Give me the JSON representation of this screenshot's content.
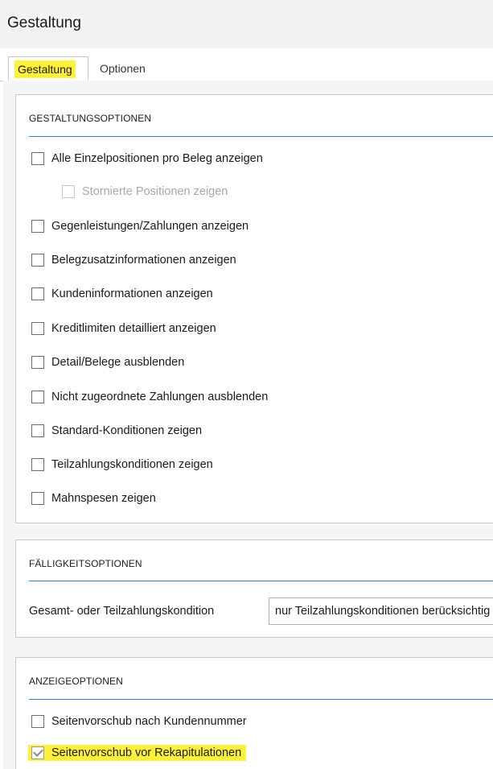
{
  "window": {
    "title": "Gestaltung"
  },
  "tabs": [
    {
      "label": "Gestaltung",
      "active": true
    },
    {
      "label": "Optionen",
      "active": false
    }
  ],
  "groups": {
    "gestaltungsoptionen": {
      "header": "GESTALTUNGSOPTIONEN",
      "items": [
        {
          "label": "Alle Einzelpositionen pro Beleg anzeigen",
          "checked": false,
          "enabled": true
        },
        {
          "label": "Stornierte Positionen zeigen",
          "checked": false,
          "enabled": false
        },
        {
          "label": "Gegenleistungen/Zahlungen anzeigen",
          "checked": false,
          "enabled": true
        },
        {
          "label": "Belegzusatzinformationen anzeigen",
          "checked": false,
          "enabled": true
        },
        {
          "label": "Kundeninformationen anzeigen",
          "checked": false,
          "enabled": true
        },
        {
          "label": "Kreditlimiten detailliert anzeigen",
          "checked": false,
          "enabled": true
        },
        {
          "label": "Detail/Belege ausblenden",
          "checked": false,
          "enabled": true
        },
        {
          "label": "Nicht zugeordnete Zahlungen ausblenden",
          "checked": false,
          "enabled": true
        },
        {
          "label": "Standard-Konditionen zeigen",
          "checked": false,
          "enabled": true
        },
        {
          "label": "Teilzahlungskonditionen zeigen",
          "checked": false,
          "enabled": true
        },
        {
          "label": "Mahnspesen zeigen",
          "checked": false,
          "enabled": true
        }
      ]
    },
    "faelligkeitsoptionen": {
      "header": "FÄLLIGKEITSOPTIONEN",
      "field_label": "Gesamt- oder Teilzahlungskondition",
      "field_value": "nur Teilzahlungskonditionen berücksichtig"
    },
    "anzeigeoptionen": {
      "header": "ANZEIGEOPTIONEN",
      "items": [
        {
          "label": "Seitenvorschub nach Kundennummer",
          "checked": false,
          "enabled": true
        },
        {
          "label": "Seitenvorschub vor Rekapitulationen",
          "checked": true,
          "enabled": true
        }
      ]
    }
  },
  "colors": {
    "highlight": "#fff03a",
    "rule": "#3a7bbf"
  }
}
